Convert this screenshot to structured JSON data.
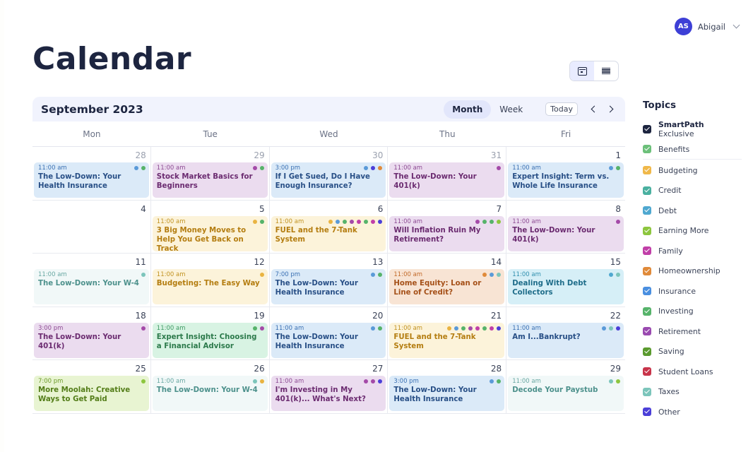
{
  "user": {
    "initials": "AS",
    "name": "Abigail"
  },
  "page_title": "Calendar",
  "calendar": {
    "month_label": "September 2023",
    "view_month": "Month",
    "view_week": "Week",
    "today": "Today",
    "weekdays": [
      "Mon",
      "Tue",
      "Wed",
      "Thu",
      "Fri"
    ],
    "weeks": [
      [
        {
          "day": "28",
          "muted": true,
          "event": {
            "time": "11:00 am",
            "title": "The Low-Down: Your Health Insurance",
            "color": "blue",
            "dots": [
              "#5a9ad8",
              "#56b36a"
            ]
          }
        },
        {
          "day": "29",
          "muted": true,
          "event": {
            "time": "11:00 am",
            "title": "Stock Market Basics for Beginners",
            "color": "purple",
            "dots": [
              "#a44aa8",
              "#56b36a"
            ]
          }
        },
        {
          "day": "30",
          "muted": true,
          "event": {
            "time": "3:00 pm",
            "title": "If I Get Sued, Do I Have Enough Insurance?",
            "color": "blue",
            "dots": [
              "#5a9ad8",
              "#4b3fd8",
              "#e08a3a"
            ]
          }
        },
        {
          "day": "31",
          "muted": true,
          "event": {
            "time": "11:00 am",
            "title": "The Low-Down: Your 401(k)",
            "color": "purple",
            "dots": [
              "#a44aa8"
            ]
          }
        },
        {
          "day": "1",
          "muted": false,
          "event": {
            "time": "11:00 am",
            "title": "Expert Insight: Term vs. Whole Life Insurance",
            "color": "blue",
            "dots": [
              "#5a9ad8",
              "#56b36a"
            ]
          }
        }
      ],
      [
        {
          "day": "4",
          "muted": false,
          "event": null
        },
        {
          "day": "5",
          "muted": false,
          "event": {
            "time": "11:00 am",
            "title": "3 Big Money Moves to Help You Get Back on Track",
            "color": "yellow",
            "dots": [
              "#e9b341",
              "#56b36a"
            ]
          }
        },
        {
          "day": "6",
          "muted": false,
          "event": {
            "time": "11:00 am",
            "title": "FUEL and the 7-Tank System",
            "color": "yellow",
            "dots": [
              "#e9b341",
              "#5a9ad8",
              "#56b36a",
              "#a44aa8",
              "#c13fa8",
              "#56b36a",
              "#c13fa8",
              "#4b3fd8"
            ]
          }
        },
        {
          "day": "7",
          "muted": false,
          "event": {
            "time": "11:00 am",
            "title": "Will Inflation Ruin My Retirement?",
            "color": "purple",
            "dots": [
              "#a44aa8",
              "#56b36a",
              "#56b36a",
              "#8dc63f"
            ]
          }
        },
        {
          "day": "8",
          "muted": false,
          "event": {
            "time": "11:00 am",
            "title": "The Low-Down: Your 401(k)",
            "color": "purple",
            "dots": [
              "#a44aa8"
            ]
          }
        }
      ],
      [
        {
          "day": "11",
          "muted": false,
          "event": {
            "time": "11:00 am",
            "title": "The Low-Down: Your W-4",
            "color": "teal",
            "dots": [
              "#7cc5bb"
            ]
          }
        },
        {
          "day": "12",
          "muted": false,
          "event": {
            "time": "11:00 am",
            "title": "Budgeting: The Easy Way",
            "color": "yellow",
            "dots": [
              "#e9b341"
            ]
          }
        },
        {
          "day": "13",
          "muted": false,
          "event": {
            "time": "7:00 pm",
            "title": "The Low-Down: Your Health Insurance",
            "color": "blue",
            "dots": [
              "#5a9ad8",
              "#56b36a"
            ]
          }
        },
        {
          "day": "14",
          "muted": false,
          "event": {
            "time": "11:00 am",
            "title": "Home Equity: Loan or Line of Credit?",
            "color": "orange",
            "dots": [
              "#e08a3a",
              "#5a9ad8",
              "#7cc5bb"
            ]
          }
        },
        {
          "day": "15",
          "muted": false,
          "event": {
            "time": "11:00 am",
            "title": "Dealing With Debt Collectors",
            "color": "cyan",
            "dots": [
              "#4fa8d0",
              "#7cc5bb"
            ]
          }
        }
      ],
      [
        {
          "day": "18",
          "muted": false,
          "event": {
            "time": "3:00 pm",
            "title": "The Low-Down: Your 401(k)",
            "color": "purple",
            "dots": [
              "#a44aa8"
            ]
          }
        },
        {
          "day": "19",
          "muted": false,
          "event": {
            "time": "11:00 am",
            "title": "Expert Insight: Choosing a Financial Advisor",
            "color": "green",
            "dots": [
              "#56b36a",
              "#a44aa8"
            ]
          }
        },
        {
          "day": "20",
          "muted": false,
          "event": {
            "time": "11:00 am",
            "title": "The Low-Down: Your Health Insurance",
            "color": "blue",
            "dots": [
              "#5a9ad8",
              "#56b36a"
            ]
          }
        },
        {
          "day": "21",
          "muted": false,
          "event": {
            "time": "11:00 am",
            "title": "FUEL and the 7-Tank System",
            "color": "yellow",
            "dots": [
              "#e9b341",
              "#5a9ad8",
              "#56b36a",
              "#a44aa8",
              "#c13fa8",
              "#56b36a",
              "#c13fa8",
              "#4b3fd8"
            ]
          }
        },
        {
          "day": "22",
          "muted": false,
          "event": {
            "time": "11:00 am",
            "title": "Am I...Bankrupt?",
            "color": "blue",
            "dots": [
              "#5a9ad8",
              "#7cc5bb",
              "#4b3fd8"
            ]
          }
        }
      ],
      [
        {
          "day": "25",
          "muted": false,
          "event": {
            "time": "7:00 pm",
            "title": "More Moolah: Creative Ways to Get Paid",
            "color": "lime",
            "dots": [
              "#8dc63f"
            ]
          }
        },
        {
          "day": "26",
          "muted": false,
          "event": {
            "time": "11:00 am",
            "title": "The Low-Down: Your W-4",
            "color": "teal",
            "dots": [
              "#7cc5bb",
              "#e9b341"
            ]
          }
        },
        {
          "day": "27",
          "muted": false,
          "event": {
            "time": "11:00 am",
            "title": "I'm Investing in My 401(k)... What's Next?",
            "color": "purple",
            "dots": [
              "#a44aa8",
              "#a44aa8",
              "#4b3fd8"
            ]
          }
        },
        {
          "day": "28",
          "muted": false,
          "event": {
            "time": "3:00 pm",
            "title": "The Low-Down: Your Health Insurance",
            "color": "blue",
            "dots": [
              "#5a9ad8",
              "#56b36a"
            ]
          }
        },
        {
          "day": "29",
          "muted": false,
          "event": {
            "time": "11:00 am",
            "title": "Decode Your Paystub",
            "color": "teal",
            "dots": [
              "#7cc5bb",
              "#8dc63f"
            ]
          }
        }
      ]
    ]
  },
  "topics": {
    "title": "Topics",
    "exclusive": {
      "bold": "SmartPath",
      "rest": " Exclusive",
      "color": "#1d2540"
    },
    "items": [
      {
        "label": "Benefits",
        "color": "#6cc07a"
      },
      {
        "label": "Budgeting",
        "color": "#f0b84a"
      },
      {
        "label": "Credit",
        "color": "#4ab0a0"
      },
      {
        "label": "Debt",
        "color": "#4fa8d0"
      },
      {
        "label": "Earning More",
        "color": "#8dc63f"
      },
      {
        "label": "Family",
        "color": "#c13fa8"
      },
      {
        "label": "Homeownership",
        "color": "#e08a3a"
      },
      {
        "label": "Insurance",
        "color": "#4a8fe0"
      },
      {
        "label": "Investing",
        "color": "#56b36a"
      },
      {
        "label": "Retirement",
        "color": "#9a4ab0"
      },
      {
        "label": "Saving",
        "color": "#5a9a2e"
      },
      {
        "label": "Student Loans",
        "color": "#c8344a"
      },
      {
        "label": "Taxes",
        "color": "#7cc5bb"
      },
      {
        "label": "Other",
        "color": "#4b3fd8"
      }
    ]
  }
}
